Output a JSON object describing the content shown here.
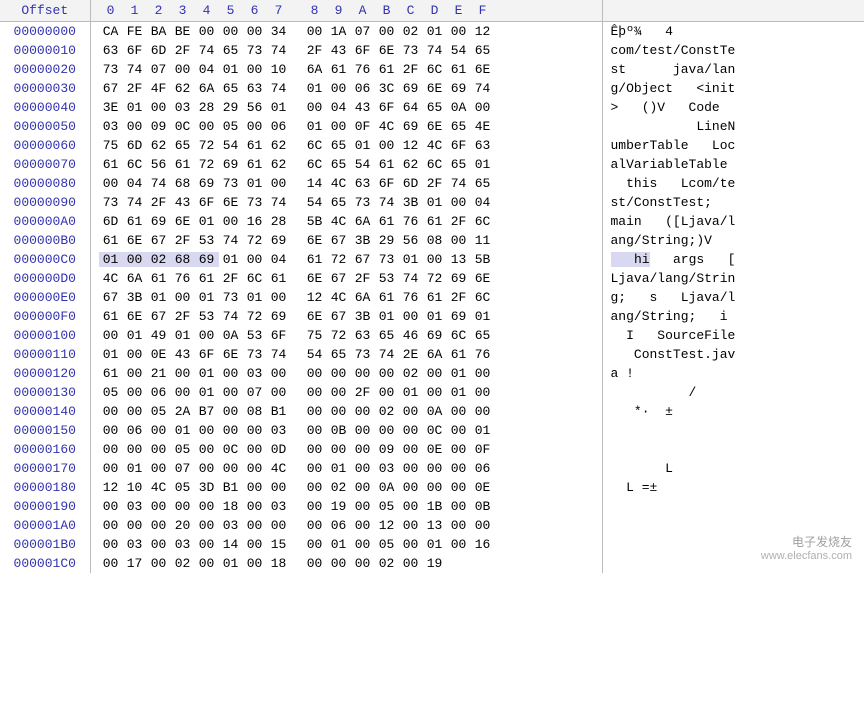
{
  "header": {
    "offset_label": "Offset",
    "columns": [
      "0",
      "1",
      "2",
      "3",
      "4",
      "5",
      "6",
      "7",
      "8",
      "9",
      "A",
      "B",
      "C",
      "D",
      "E",
      "F"
    ]
  },
  "highlight": {
    "row_index": 12,
    "start": 0,
    "end": 4
  },
  "rows": [
    {
      "offset": "00000000",
      "hex": [
        "CA",
        "FE",
        "BA",
        "BE",
        "00",
        "00",
        "00",
        "34",
        "00",
        "1A",
        "07",
        "00",
        "02",
        "01",
        "00",
        "12"
      ],
      "ascii": "Êþº¾   4        "
    },
    {
      "offset": "00000010",
      "hex": [
        "63",
        "6F",
        "6D",
        "2F",
        "74",
        "65",
        "73",
        "74",
        "2F",
        "43",
        "6F",
        "6E",
        "73",
        "74",
        "54",
        "65"
      ],
      "ascii": "com/test/ConstTe"
    },
    {
      "offset": "00000020",
      "hex": [
        "73",
        "74",
        "07",
        "00",
        "04",
        "01",
        "00",
        "10",
        "6A",
        "61",
        "76",
        "61",
        "2F",
        "6C",
        "61",
        "6E"
      ],
      "ascii": "st      java/lan"
    },
    {
      "offset": "00000030",
      "hex": [
        "67",
        "2F",
        "4F",
        "62",
        "6A",
        "65",
        "63",
        "74",
        "01",
        "00",
        "06",
        "3C",
        "69",
        "6E",
        "69",
        "74"
      ],
      "ascii": "g/Object   <init"
    },
    {
      "offset": "00000040",
      "hex": [
        "3E",
        "01",
        "00",
        "03",
        "28",
        "29",
        "56",
        "01",
        "00",
        "04",
        "43",
        "6F",
        "64",
        "65",
        "0A",
        "00"
      ],
      "ascii": ">   ()V   Code  "
    },
    {
      "offset": "00000050",
      "hex": [
        "03",
        "00",
        "09",
        "0C",
        "00",
        "05",
        "00",
        "06",
        "01",
        "00",
        "0F",
        "4C",
        "69",
        "6E",
        "65",
        "4E"
      ],
      "ascii": "           LineN"
    },
    {
      "offset": "00000060",
      "hex": [
        "75",
        "6D",
        "62",
        "65",
        "72",
        "54",
        "61",
        "62",
        "6C",
        "65",
        "01",
        "00",
        "12",
        "4C",
        "6F",
        "63"
      ],
      "ascii": "umberTable   Loc"
    },
    {
      "offset": "00000070",
      "hex": [
        "61",
        "6C",
        "56",
        "61",
        "72",
        "69",
        "61",
        "62",
        "6C",
        "65",
        "54",
        "61",
        "62",
        "6C",
        "65",
        "01"
      ],
      "ascii": "alVariableTable "
    },
    {
      "offset": "00000080",
      "hex": [
        "00",
        "04",
        "74",
        "68",
        "69",
        "73",
        "01",
        "00",
        "14",
        "4C",
        "63",
        "6F",
        "6D",
        "2F",
        "74",
        "65"
      ],
      "ascii": "  this   Lcom/te"
    },
    {
      "offset": "00000090",
      "hex": [
        "73",
        "74",
        "2F",
        "43",
        "6F",
        "6E",
        "73",
        "74",
        "54",
        "65",
        "73",
        "74",
        "3B",
        "01",
        "00",
        "04"
      ],
      "ascii": "st/ConstTest;   "
    },
    {
      "offset": "000000A0",
      "hex": [
        "6D",
        "61",
        "69",
        "6E",
        "01",
        "00",
        "16",
        "28",
        "5B",
        "4C",
        "6A",
        "61",
        "76",
        "61",
        "2F",
        "6C"
      ],
      "ascii": "main   ([Ljava/l"
    },
    {
      "offset": "000000B0",
      "hex": [
        "61",
        "6E",
        "67",
        "2F",
        "53",
        "74",
        "72",
        "69",
        "6E",
        "67",
        "3B",
        "29",
        "56",
        "08",
        "00",
        "11"
      ],
      "ascii": "ang/String;)V   "
    },
    {
      "offset": "000000C0",
      "hex": [
        "01",
        "00",
        "02",
        "68",
        "69",
        "01",
        "00",
        "04",
        "61",
        "72",
        "67",
        "73",
        "01",
        "00",
        "13",
        "5B"
      ],
      "ascii": "   hi   args   ["
    },
    {
      "offset": "000000D0",
      "hex": [
        "4C",
        "6A",
        "61",
        "76",
        "61",
        "2F",
        "6C",
        "61",
        "6E",
        "67",
        "2F",
        "53",
        "74",
        "72",
        "69",
        "6E"
      ],
      "ascii": "Ljava/lang/Strin"
    },
    {
      "offset": "000000E0",
      "hex": [
        "67",
        "3B",
        "01",
        "00",
        "01",
        "73",
        "01",
        "00",
        "12",
        "4C",
        "6A",
        "61",
        "76",
        "61",
        "2F",
        "6C"
      ],
      "ascii": "g;   s   Ljava/l"
    },
    {
      "offset": "000000F0",
      "hex": [
        "61",
        "6E",
        "67",
        "2F",
        "53",
        "74",
        "72",
        "69",
        "6E",
        "67",
        "3B",
        "01",
        "00",
        "01",
        "69",
        "01"
      ],
      "ascii": "ang/String;   i "
    },
    {
      "offset": "00000100",
      "hex": [
        "00",
        "01",
        "49",
        "01",
        "00",
        "0A",
        "53",
        "6F",
        "75",
        "72",
        "63",
        "65",
        "46",
        "69",
        "6C",
        "65"
      ],
      "ascii": "  I   SourceFile"
    },
    {
      "offset": "00000110",
      "hex": [
        "01",
        "00",
        "0E",
        "43",
        "6F",
        "6E",
        "73",
        "74",
        "54",
        "65",
        "73",
        "74",
        "2E",
        "6A",
        "61",
        "76"
      ],
      "ascii": "   ConstTest.jav"
    },
    {
      "offset": "00000120",
      "hex": [
        "61",
        "00",
        "21",
        "00",
        "01",
        "00",
        "03",
        "00",
        "00",
        "00",
        "00",
        "00",
        "02",
        "00",
        "01",
        "00"
      ],
      "ascii": "a !             "
    },
    {
      "offset": "00000130",
      "hex": [
        "05",
        "00",
        "06",
        "00",
        "01",
        "00",
        "07",
        "00",
        "00",
        "00",
        "2F",
        "00",
        "01",
        "00",
        "01",
        "00"
      ],
      "ascii": "          /     "
    },
    {
      "offset": "00000140",
      "hex": [
        "00",
        "00",
        "05",
        "2A",
        "B7",
        "00",
        "08",
        "B1",
        "00",
        "00",
        "00",
        "02",
        "00",
        "0A",
        "00",
        "00"
      ],
      "ascii": "   *·  ±        "
    },
    {
      "offset": "00000150",
      "hex": [
        "00",
        "06",
        "00",
        "01",
        "00",
        "00",
        "00",
        "03",
        "00",
        "0B",
        "00",
        "00",
        "00",
        "0C",
        "00",
        "01"
      ],
      "ascii": "                "
    },
    {
      "offset": "00000160",
      "hex": [
        "00",
        "00",
        "00",
        "05",
        "00",
        "0C",
        "00",
        "0D",
        "00",
        "00",
        "00",
        "09",
        "00",
        "0E",
        "00",
        "0F"
      ],
      "ascii": "                "
    },
    {
      "offset": "00000170",
      "hex": [
        "00",
        "01",
        "00",
        "07",
        "00",
        "00",
        "00",
        "4C",
        "00",
        "01",
        "00",
        "03",
        "00",
        "00",
        "00",
        "06"
      ],
      "ascii": "       L        "
    },
    {
      "offset": "00000180",
      "hex": [
        "12",
        "10",
        "4C",
        "05",
        "3D",
        "B1",
        "00",
        "00",
        "00",
        "02",
        "00",
        "0A",
        "00",
        "00",
        "00",
        "0E"
      ],
      "ascii": "  L =±          "
    },
    {
      "offset": "00000190",
      "hex": [
        "00",
        "03",
        "00",
        "00",
        "00",
        "18",
        "00",
        "03",
        "00",
        "19",
        "00",
        "05",
        "00",
        "1B",
        "00",
        "0B"
      ],
      "ascii": "                "
    },
    {
      "offset": "000001A0",
      "hex": [
        "00",
        "00",
        "00",
        "20",
        "00",
        "03",
        "00",
        "00",
        "00",
        "06",
        "00",
        "12",
        "00",
        "13",
        "00",
        "00"
      ],
      "ascii": "                "
    },
    {
      "offset": "000001B0",
      "hex": [
        "00",
        "03",
        "00",
        "03",
        "00",
        "14",
        "00",
        "15",
        "00",
        "01",
        "00",
        "05",
        "00",
        "01",
        "00",
        "16"
      ],
      "ascii": "                "
    },
    {
      "offset": "000001C0",
      "hex": [
        "00",
        "17",
        "00",
        "02",
        "00",
        "01",
        "00",
        "18",
        "00",
        "00",
        "00",
        "02",
        "00",
        "19"
      ],
      "ascii": "              "
    }
  ],
  "watermark": {
    "brand_cn": "电子发烧友",
    "url": "www.elecfans.com"
  }
}
